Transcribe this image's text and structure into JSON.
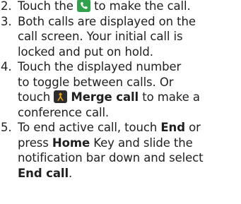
{
  "steps": [
    {
      "number": "2.",
      "lines": [
        {
          "before": "Touch the",
          "after": "to make the call."
        }
      ]
    },
    {
      "number": "3.",
      "lines": [
        "Both calls are displayed on the",
        "call screen. Your initial call is",
        "locked and put on hold."
      ]
    },
    {
      "number": "4.",
      "lines": [
        "Touch the displayed number",
        "to toggle between calls. Or",
        {
          "before": "touch",
          "bold": "Merge call",
          "after": "to make a"
        },
        "conference call."
      ]
    },
    {
      "number": "5.",
      "lines": [
        {
          "before": "To end active call, touch",
          "bold": "End",
          "after": "or"
        },
        {
          "before": "press",
          "bold": "Home",
          "after": "Key and slide the"
        },
        "notification bar down and select",
        {
          "bold": "End call",
          "after": "."
        }
      ]
    }
  ],
  "icons": {
    "phone": {
      "name": "phone-icon",
      "color": "#31a24c"
    },
    "merge": {
      "name": "merge-call-icon",
      "color": "#2c2c2c"
    }
  }
}
